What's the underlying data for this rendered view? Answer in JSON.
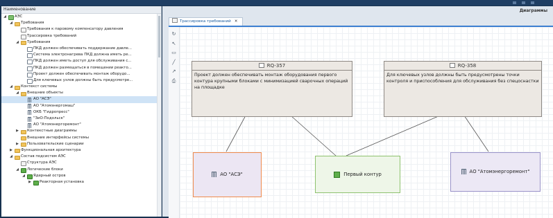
{
  "tree": {
    "header": "Наименование",
    "rows": [
      {
        "label": "АЭС",
        "icon": "block",
        "toggle": "◢",
        "indent": 0
      },
      {
        "label": "Требования",
        "icon": "folder",
        "toggle": "◢",
        "indent": 1
      },
      {
        "label": "Требования к паровому компенсатору давления",
        "icon": "diagram",
        "toggle": "",
        "indent": 2
      },
      {
        "label": "Трассировка требований",
        "icon": "diagram",
        "toggle": "",
        "indent": 2
      },
      {
        "label": "Требования",
        "icon": "folder",
        "toggle": "◢",
        "indent": 2
      },
      {
        "label": "ПКД должен обеспечивать поддержание давле...",
        "icon": "req",
        "toggle": "",
        "indent": 3
      },
      {
        "label": "Система электронагрева ПКД должна иметь ре...",
        "icon": "req",
        "toggle": "",
        "indent": 3
      },
      {
        "label": "ПКД должен иметь доступ для обслуживания с...",
        "icon": "req",
        "toggle": "",
        "indent": 3
      },
      {
        "label": "ПКД должен размещаться в помещении реакто...",
        "icon": "req",
        "toggle": "",
        "indent": 3
      },
      {
        "label": "Проект должен обеспечивать монтаж оборудо...",
        "icon": "req",
        "toggle": "",
        "indent": 3
      },
      {
        "label": "Для ключевых узлов должны быть предусмотре...",
        "icon": "req",
        "toggle": "",
        "indent": 3
      },
      {
        "label": "Контекст системы",
        "icon": "folder",
        "toggle": "◢",
        "indent": 1
      },
      {
        "label": "Внешние объекты",
        "icon": "folder",
        "toggle": "◢",
        "indent": 2
      },
      {
        "label": "АО \"АСЭ\"",
        "icon": "org",
        "toggle": "",
        "indent": 3,
        "selected": true
      },
      {
        "label": "АО \"Атомэнергомаш\"",
        "icon": "org",
        "toggle": "",
        "indent": 3
      },
      {
        "label": "ОКБ \"Гидропресс\"",
        "icon": "org",
        "toggle": "",
        "indent": 3
      },
      {
        "label": "\"ЗиО-Подольск\"",
        "icon": "org",
        "toggle": "",
        "indent": 3
      },
      {
        "label": "АО \"Атомэнергоремонт\"",
        "icon": "org",
        "toggle": "",
        "indent": 3
      },
      {
        "label": "Контекстные диаграммы",
        "icon": "folder",
        "toggle": "▶",
        "indent": 2
      },
      {
        "label": "Внешние интерфейсы системы",
        "icon": "folder",
        "toggle": "",
        "indent": 2
      },
      {
        "label": "Пользовательские сценарии",
        "icon": "folder",
        "toggle": "▶",
        "indent": 2
      },
      {
        "label": "Функциональная архитектура",
        "icon": "folder",
        "toggle": "▶",
        "indent": 1
      },
      {
        "label": "Состав подсистем АЭС",
        "icon": "folder",
        "toggle": "◢",
        "indent": 1
      },
      {
        "label": "Структура АЭС",
        "icon": "diagram",
        "toggle": "",
        "indent": 2
      },
      {
        "label": "Логические блоки",
        "icon": "green",
        "toggle": "◢",
        "indent": 2
      },
      {
        "label": "Ядерный остров",
        "icon": "green",
        "toggle": "◢",
        "indent": 3
      },
      {
        "label": "Реакторная установка",
        "icon": "green",
        "toggle": "▶",
        "indent": 4
      }
    ]
  },
  "header": {
    "diagrams_label": "Диаграммы"
  },
  "tab": {
    "label": "Трассировка требований",
    "close": "✕"
  },
  "toolbar": {
    "tools": [
      {
        "name": "refresh-icon",
        "glyph": "↻"
      },
      {
        "name": "pointer-icon",
        "glyph": "↖"
      },
      {
        "name": "frame-icon",
        "glyph": "▭"
      },
      {
        "name": "line-icon",
        "glyph": "╱"
      },
      {
        "name": "arrow-icon",
        "glyph": "↗"
      },
      {
        "name": "print-icon",
        "glyph": "⎙"
      }
    ]
  },
  "diagram": {
    "requirements": [
      {
        "id": "RQ-357",
        "text": "Проект должен обеспечивать монтаж оборудования первого контура крупными блоками с минимизацией сварочных операций на площадке"
      },
      {
        "id": "RQ-358",
        "text": "Для ключевых узлов должны быть предусмотрены точки контроля и приспособления для обслуживания без спецоснастки"
      }
    ],
    "blocks": [
      {
        "label": "АО \"АСЭ\"",
        "kind": "org",
        "border": "#f08a4b",
        "fill": "#ece6f3"
      },
      {
        "label": "Первый контур",
        "kind": "green",
        "border": "#8ec26e",
        "fill": "#eef6e8"
      },
      {
        "label": "АО \"Атомэнергоремонт\"",
        "kind": "org",
        "border": "#9a93c9",
        "fill": "#ece8f5"
      }
    ]
  },
  "colors": {
    "accent": "#3c7fd1",
    "app_bg": "#17324f",
    "selected_row": "#cfe3f6"
  }
}
